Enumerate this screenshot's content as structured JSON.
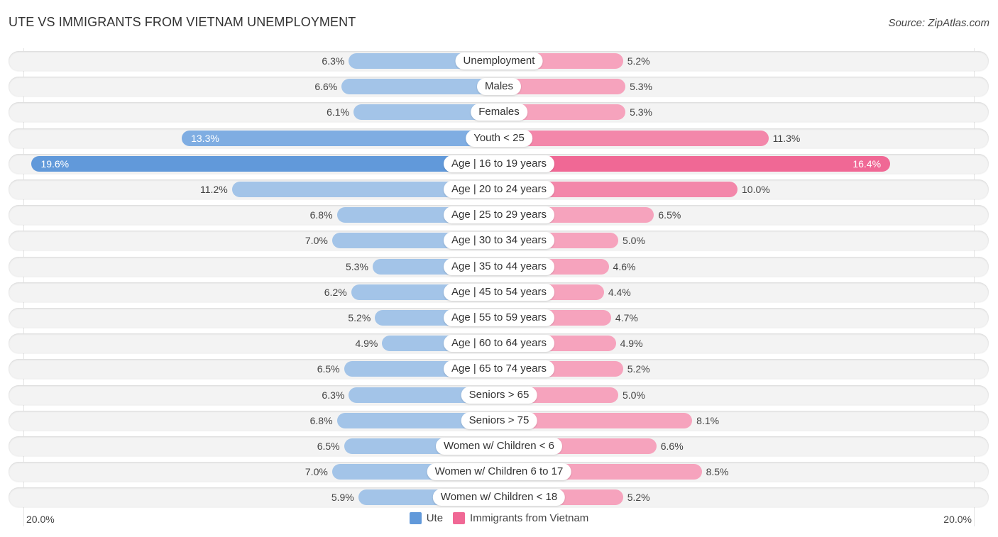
{
  "title": "UTE VS IMMIGRANTS FROM VIETNAM UNEMPLOYMENT",
  "source": "Source: ZipAtlas.com",
  "colors": {
    "left_light": "#a3c4e8",
    "left_strong": "#6199da",
    "right_light": "#f6a3bd",
    "right_strong": "#f06895"
  },
  "chart_data": {
    "type": "bar",
    "orientation": "horizontal-diverging",
    "title": "UTE VS IMMIGRANTS FROM VIETNAM UNEMPLOYMENT",
    "xlabel": "",
    "ylabel": "",
    "xlim": [
      0,
      20.0
    ],
    "axis_min_label": "20.0%",
    "axis_max_label": "20.0%",
    "legend_position": "bottom-center",
    "grid": false,
    "categories": [
      "Unemployment",
      "Males",
      "Females",
      "Youth < 25",
      "Age | 16 to 19 years",
      "Age | 20 to 24 years",
      "Age | 25 to 29 years",
      "Age | 30 to 34 years",
      "Age | 35 to 44 years",
      "Age | 45 to 54 years",
      "Age | 55 to 59 years",
      "Age | 60 to 64 years",
      "Age | 65 to 74 years",
      "Seniors > 65",
      "Seniors > 75",
      "Women w/ Children < 6",
      "Women w/ Children 6 to 17",
      "Women w/ Children < 18"
    ],
    "series": [
      {
        "name": "Ute",
        "side": "left",
        "values": [
          6.3,
          6.6,
          6.1,
          13.3,
          19.6,
          11.2,
          6.8,
          7.0,
          5.3,
          6.2,
          5.2,
          4.9,
          6.5,
          6.3,
          6.8,
          6.5,
          7.0,
          5.9
        ],
        "labels": [
          "6.3%",
          "6.6%",
          "6.1%",
          "13.3%",
          "19.6%",
          "11.2%",
          "6.8%",
          "7.0%",
          "5.3%",
          "6.2%",
          "5.2%",
          "4.9%",
          "6.5%",
          "6.3%",
          "6.8%",
          "6.5%",
          "7.0%",
          "5.9%"
        ]
      },
      {
        "name": "Immigrants from Vietnam",
        "side": "right",
        "values": [
          5.2,
          5.3,
          5.3,
          11.3,
          16.4,
          10.0,
          6.5,
          5.0,
          4.6,
          4.4,
          4.7,
          4.9,
          5.2,
          5.0,
          8.1,
          6.6,
          8.5,
          5.2
        ],
        "labels": [
          "5.2%",
          "5.3%",
          "5.3%",
          "11.3%",
          "16.4%",
          "10.0%",
          "6.5%",
          "5.0%",
          "4.6%",
          "4.4%",
          "4.7%",
          "4.9%",
          "5.2%",
          "5.0%",
          "8.1%",
          "6.6%",
          "8.5%",
          "5.2%"
        ]
      }
    ]
  },
  "legend": [
    {
      "label": "Ute",
      "color": "#6199da"
    },
    {
      "label": "Immigrants from Vietnam",
      "color": "#f06895"
    }
  ]
}
